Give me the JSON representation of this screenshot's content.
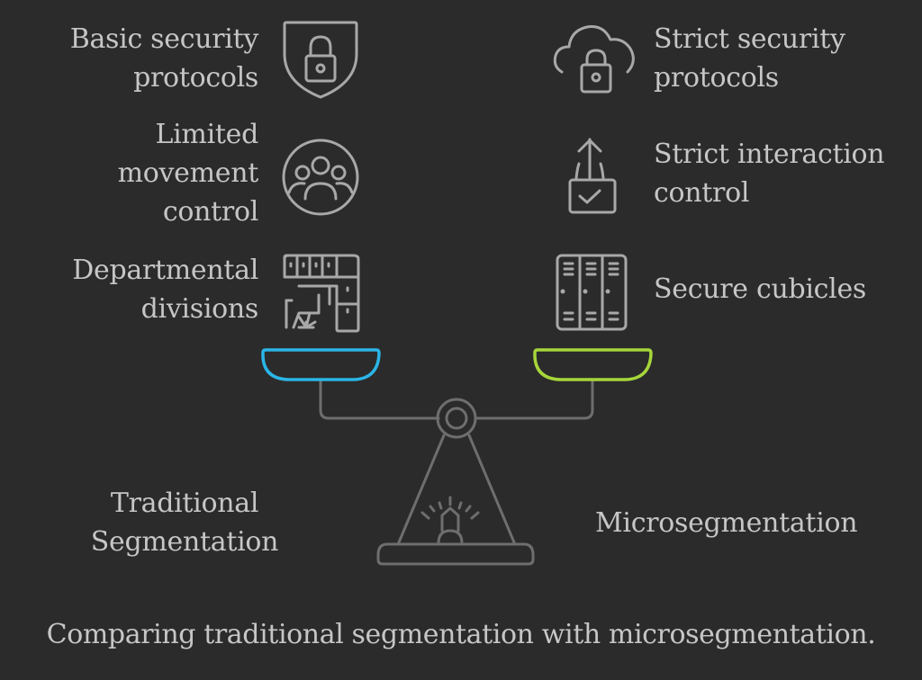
{
  "left": {
    "title": "Traditional\nSegmentation",
    "accent": "#2bb5e6",
    "items": [
      {
        "label": "Basic security\nprotocols",
        "icon": "shield-lock-icon"
      },
      {
        "label": "Limited\nmovement\ncontrol",
        "icon": "group-circle-icon"
      },
      {
        "label": "Departmental\ndivisions",
        "icon": "office-layout-icon"
      }
    ]
  },
  "right": {
    "title": "Microsegmentation",
    "accent": "#a6d63a",
    "items": [
      {
        "label": "Strict security\nprotocols",
        "icon": "cloud-lock-icon"
      },
      {
        "label": "Strict interaction\ncontrol",
        "icon": "lock-upload-check-icon"
      },
      {
        "label": "Secure cubicles",
        "icon": "lockers-icon"
      }
    ]
  },
  "caption": "Comparing traditional segmentation with microsegmentation."
}
